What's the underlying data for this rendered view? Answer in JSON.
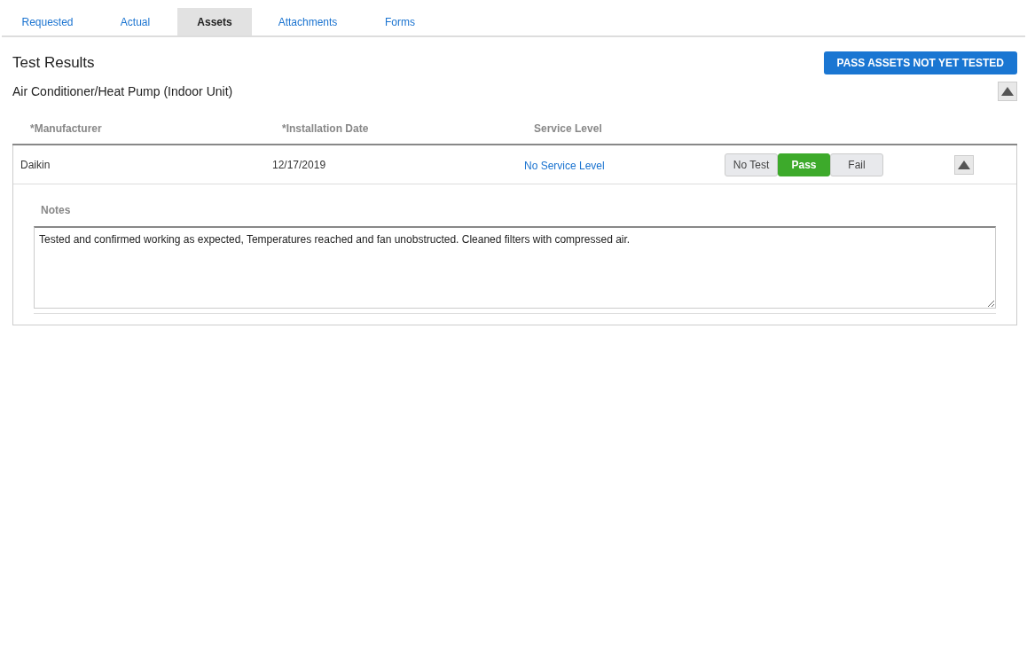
{
  "tabs": [
    {
      "label": "Requested",
      "selected": false
    },
    {
      "label": "Actual",
      "selected": false
    },
    {
      "label": "Assets",
      "selected": true
    },
    {
      "label": "Attachments",
      "selected": false
    },
    {
      "label": "Forms",
      "selected": false
    }
  ],
  "title": "Test Results",
  "pass_button": "PASS ASSETS NOT YET TESTED",
  "asset_group": {
    "name": "Air Conditioner/Heat Pump (Indoor Unit)",
    "expanded": true,
    "columns": [
      "*Manufacturer",
      "*Installation Date",
      "Service Level"
    ],
    "rows": [
      {
        "manufacturer": "Daikin",
        "installation_date": "12/17/2019",
        "service_level": "No Service Level",
        "expanded": true,
        "results": [
          {
            "label": "No Test",
            "selected": false
          },
          {
            "label": "Pass",
            "selected": true
          },
          {
            "label": "Fail",
            "selected": false
          }
        ],
        "notes_label": "Notes",
        "notes": "Tested and confirmed working as expected, Temperatures reached and fan unobstructed. Cleaned filters with compressed air."
      }
    ]
  }
}
